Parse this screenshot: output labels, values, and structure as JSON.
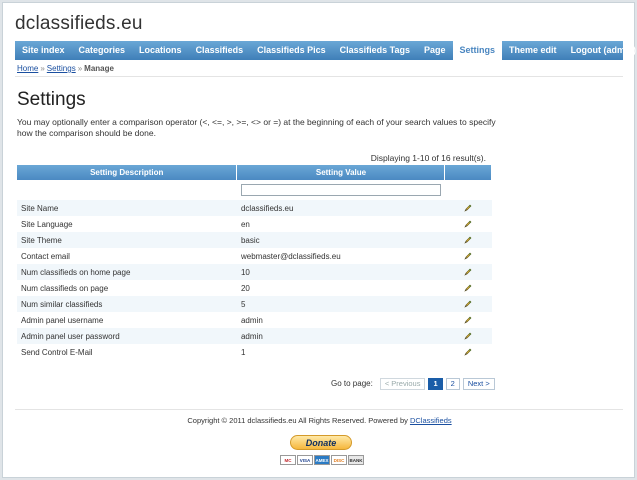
{
  "site": {
    "title": "dclassifieds.eu"
  },
  "nav": {
    "items": [
      {
        "label": "Site index"
      },
      {
        "label": "Categories"
      },
      {
        "label": "Locations"
      },
      {
        "label": "Classifieds"
      },
      {
        "label": "Classifieds Pics"
      },
      {
        "label": "Classifieds Tags"
      },
      {
        "label": "Page"
      },
      {
        "label": "Settings",
        "active": true
      },
      {
        "label": "Theme edit"
      },
      {
        "label": "Logout (admin)"
      }
    ]
  },
  "breadcrumb": {
    "home": "Home",
    "settings": "Settings",
    "current": "Manage",
    "separator": "»"
  },
  "page": {
    "title": "Settings",
    "intro": "You may optionally enter a comparison operator (<, <=, >, >=, <> or =) at the beginning of each of your search values to specify how the comparison should be done."
  },
  "grid": {
    "summary": "Displaying 1-10 of 16 result(s).",
    "headers": {
      "description": "Setting Description",
      "value": "Setting Value"
    },
    "filter_value": "",
    "rows": [
      {
        "description": "Site Name",
        "value": "dclassifieds.eu"
      },
      {
        "description": "Site Language",
        "value": "en"
      },
      {
        "description": "Site Theme",
        "value": "basic"
      },
      {
        "description": "Contact email",
        "value": "webmaster@dclassifieds.eu"
      },
      {
        "description": "Num classifieds on home page",
        "value": "10"
      },
      {
        "description": "Num classifieds on page",
        "value": "20"
      },
      {
        "description": "Num similar classifieds",
        "value": "5"
      },
      {
        "description": "Admin panel username",
        "value": "admin"
      },
      {
        "description": "Admin panel user password",
        "value": "admin"
      },
      {
        "description": "Send Control E-Mail",
        "value": "1"
      }
    ],
    "row_icon": "pencil-edit-icon"
  },
  "pager": {
    "label": "Go to page:",
    "previous": "< Previous",
    "pages": [
      "1",
      "2"
    ],
    "current_page": "1",
    "next": "Next >"
  },
  "footer": {
    "copyright": "Copyright © 2011 dclassifieds.eu All Rights Reserved.  Powered by ",
    "powered_link": "DClassifieds",
    "donate": "Donate",
    "cards": [
      "MC",
      "VISA",
      "AMEX",
      "DISC",
      "BANK"
    ]
  },
  "colors": {
    "nav": "#4b89c2",
    "link": "#1a4fa0",
    "row_alt": "#f1f7fb"
  }
}
